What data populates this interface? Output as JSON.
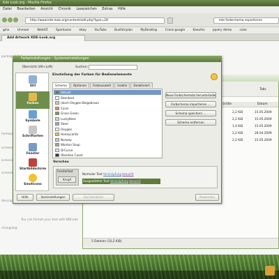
{
  "browser": {
    "title": "Kde Look.org - Mozilla Firefox",
    "menu": [
      "Datei",
      "Bearbeiten",
      "Ansicht",
      "Chronik",
      "Lesezeichen",
      "Extras",
      "Hilfe"
    ],
    "url": "http://www.kde-look.org/content/add.php?type=28",
    "search_value": "kde farbschema exportieren",
    "bookmarks": [
      "gmx",
      "Unmaer",
      "WebVZ",
      "Sparkasse",
      "ebay",
      "YouTube",
      "Busfahrplan",
      "MyDesktop",
      "Crack-google",
      "Kaeufes",
      "jquery demo",
      "color"
    ],
    "tab_label": "Add Artwork KDE-Look.org"
  },
  "page": {
    "side_texts": [
      "packaged for:",
      "homepage:",
      "screenshot:",
      "screenshot:",
      "screenshot:",
      "description:",
      "changelog:"
    ],
    "note": "You can format your text with BBCode"
  },
  "filemanager": {
    "tab_button": "Tabs",
    "columns": {
      "size": "Größe",
      "date": "Datum"
    },
    "rows": [
      {
        "size": "2,2 KiB",
        "date": "15.05.2009"
      },
      {
        "size": "2,2 KiB",
        "date": "15.05.2009"
      },
      {
        "size": "1,4 KiB",
        "date": "15.05.2009"
      },
      {
        "size": "2,2 KiB",
        "date": "28.04.2009"
      },
      {
        "size": "2,2 KiB",
        "date": "15.05.2009"
      }
    ],
    "status": "5 Dateien (10,2 KiB)"
  },
  "dialog": {
    "title": "Farbeinstellungen - Systemeinstellungen",
    "back": "Übersicht (Alt+Left)",
    "search_label": "Suchen:",
    "heading": "Einstellung der Farben für Bedienelemente",
    "sidebar": [
      {
        "label": "Stil",
        "color": "#8fb0d8"
      },
      {
        "label": "Farben",
        "color": "#e6b84a"
      },
      {
        "label": "Symbole",
        "color": "#6aa0d0"
      },
      {
        "label": "Schriftarten",
        "color": "#c8c8c8"
      },
      {
        "label": "Fenster",
        "color": "#7a9cc4"
      },
      {
        "label": "Startbildschirm",
        "color": "#c04040"
      },
      {
        "label": "Emoticons",
        "color": "#f2c230"
      }
    ],
    "tabs": [
      "Schema",
      "Optionen",
      "Farbauswahl",
      "Inaktiv",
      "Deaktiviert"
    ],
    "schemes": [
      {
        "name": "Aktuell",
        "color": "#5f7f3f"
      },
      {
        "name": "Standard",
        "color": "#ffffff"
      },
      {
        "name": "(doch-Oxygen-Beigebraun",
        "color": "#d6c8a6"
      },
      {
        "name": "Coral",
        "color": "#e08a70"
      },
      {
        "name": "Grass Green",
        "color": "#6fa04a"
      },
      {
        "name": "LuckyKees",
        "color": "#cfd8e4"
      },
      {
        "name": "Steel",
        "color": "#9aa8b6"
      },
      {
        "name": "Oxygen",
        "color": "#f2f2f0"
      },
      {
        "name": "Honeycomb",
        "color": "#e8c050"
      },
      {
        "name": "Norway",
        "color": "#c0d0e0"
      },
      {
        "name": "Wonton Soup",
        "color": "#a0a890"
      },
      {
        "name": "DrCurve",
        "color": "#e0e0d8"
      },
      {
        "name": "Obsidian Coast",
        "color": "#303838"
      }
    ],
    "buttons": {
      "import_new": "Neue Farbschemata herunterladen ...",
      "import_file": "Farbschema importieren ...",
      "save": "Schema speichern ...",
      "delete": "Schema entfernen"
    },
    "preview": {
      "label": "Vorschau",
      "window_title": "Fenstertext",
      "button": "Knopf",
      "normal": "Normaler Text",
      "link": "Verknüpfung",
      "visited": "besucht",
      "sel": "Ausgewählter Text"
    },
    "footer": {
      "help": "Hilfe",
      "defaults": "Voreinstellungen",
      "reset": "Zurücksetzen",
      "apply": "Anwenden"
    }
  }
}
